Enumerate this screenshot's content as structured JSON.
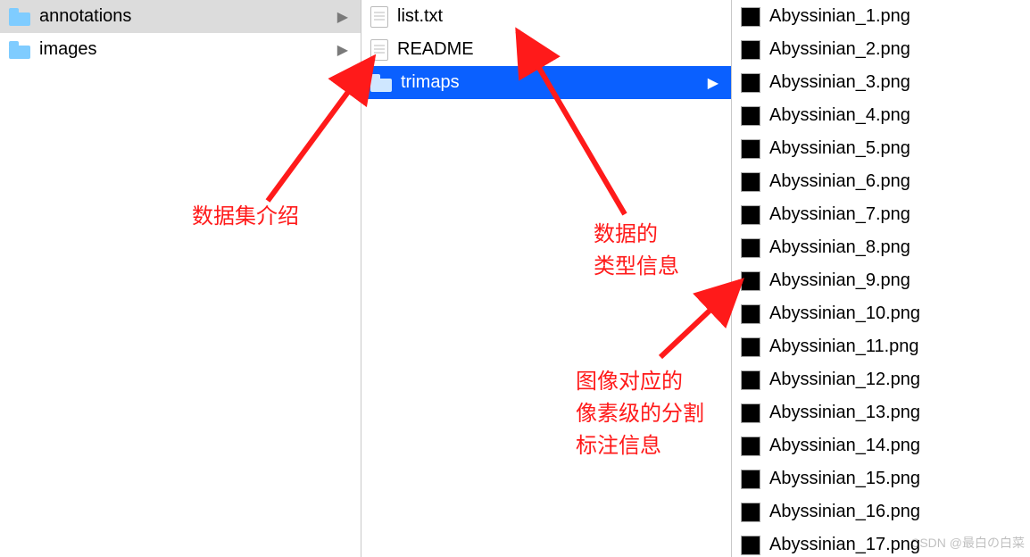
{
  "col1": {
    "items": [
      {
        "name": "annotations",
        "type": "folder",
        "selected": true,
        "hasChildren": true
      },
      {
        "name": "images",
        "type": "folder",
        "selected": false,
        "hasChildren": true
      }
    ]
  },
  "col2": {
    "items": [
      {
        "name": "list.txt",
        "type": "file",
        "selected": false
      },
      {
        "name": "README",
        "type": "file",
        "selected": false
      },
      {
        "name": "trimaps",
        "type": "folder",
        "selected": true,
        "hasChildren": true
      }
    ]
  },
  "col3": {
    "items": [
      {
        "name": "Abyssinian_1.png"
      },
      {
        "name": "Abyssinian_2.png"
      },
      {
        "name": "Abyssinian_3.png"
      },
      {
        "name": "Abyssinian_4.png"
      },
      {
        "name": "Abyssinian_5.png"
      },
      {
        "name": "Abyssinian_6.png"
      },
      {
        "name": "Abyssinian_7.png"
      },
      {
        "name": "Abyssinian_8.png"
      },
      {
        "name": "Abyssinian_9.png"
      },
      {
        "name": "Abyssinian_10.png"
      },
      {
        "name": "Abyssinian_11.png"
      },
      {
        "name": "Abyssinian_12.png"
      },
      {
        "name": "Abyssinian_13.png"
      },
      {
        "name": "Abyssinian_14.png"
      },
      {
        "name": "Abyssinian_15.png"
      },
      {
        "name": "Abyssinian_16.png"
      },
      {
        "name": "Abyssinian_17.png"
      }
    ]
  },
  "annotations": {
    "a1": "数据集介绍",
    "a2": "数据的\n类型信息",
    "a3": "图像对应的\n像素级的分割\n标注信息"
  },
  "watermark": "CSDN @最白の白菜"
}
